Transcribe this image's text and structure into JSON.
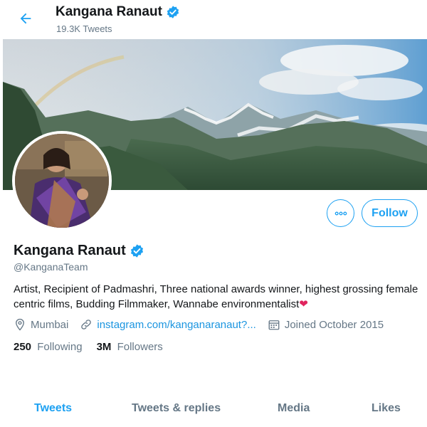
{
  "header": {
    "name": "Kangana Ranaut",
    "tweet_count": "19.3K Tweets",
    "back_icon": "arrow-left-icon"
  },
  "profile": {
    "name": "Kangana Ranaut",
    "verified": true,
    "handle": "@KanganaTeam",
    "bio": "Artist, Recipient of Padmashri, Three national awards winner, highest grossing female centric films, Budding Filmmaker, Wannabe environmentalist",
    "bio_emoji": "❤",
    "location": "Mumbai",
    "website": "instagram.com/kanganaranaut?...",
    "joined": "Joined October 2015",
    "following_count": "250",
    "following_label": "Following",
    "followers_count": "3M",
    "followers_label": "Followers"
  },
  "actions": {
    "follow_label": "Follow",
    "more_icon": "more-horizontal-icon"
  },
  "tabs": [
    {
      "label": "Tweets",
      "active": true
    },
    {
      "label": "Tweets & replies",
      "active": false
    },
    {
      "label": "Media",
      "active": false
    },
    {
      "label": "Likes",
      "active": false
    }
  ],
  "colors": {
    "accent": "#1da1f2",
    "link": "#1b95e0",
    "muted": "#657786",
    "text": "#14171a",
    "heart": "#e0245e"
  }
}
